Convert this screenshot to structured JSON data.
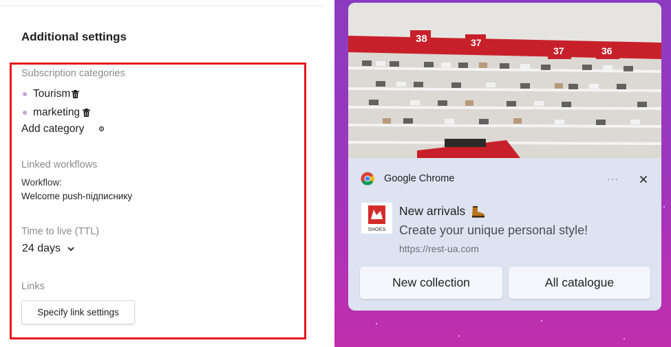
{
  "settings": {
    "heading": "Additional settings",
    "subscription_label": "Subscription categories",
    "categories": [
      {
        "label": "Tourism"
      },
      {
        "label": "marketing"
      }
    ],
    "add_category": "Add category",
    "linked_workflows_label": "Linked workflows",
    "workflow_label": "Workflow:",
    "workflow_value": "Welcome push-підписнику",
    "ttl_label": "Time to live (TTL)",
    "ttl_value": "24 days",
    "links_label": "Links",
    "link_button": "Specify link settings",
    "highlight_color": "#e8141a"
  },
  "notification": {
    "app_name": "Google Chrome",
    "more_label": "···",
    "title": "New arrivals",
    "body": "Create your unique personal style!",
    "url": "https://rest-ua.com",
    "icon_text": "SHOES",
    "image_signs": [
      "38",
      "37",
      "37",
      "36"
    ],
    "actions": [
      "New collection",
      "All catalogue"
    ],
    "background_color": "#9b37bf",
    "card_color": "#dde3f0"
  }
}
